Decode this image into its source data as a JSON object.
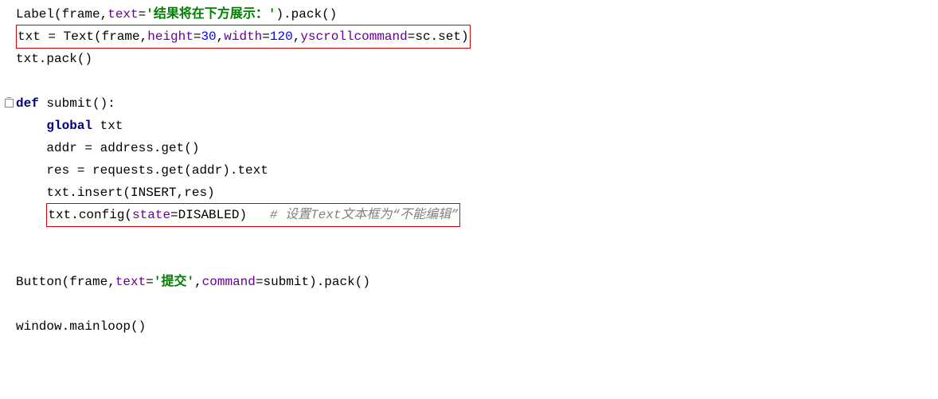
{
  "code": {
    "line1": {
      "t1": "Label(frame,",
      "t2": "text",
      "t3": "=",
      "t4": "'结果将在下方展示：'",
      "t5": ").pack()"
    },
    "line2": {
      "t1": "txt = Text(frame,",
      "t2": "height",
      "t3": "=",
      "t4": "30",
      "t5": ",",
      "t6": "width",
      "t7": "=",
      "t8": "120",
      "t9": ",",
      "t10": "yscrollcommand",
      "t11": "=sc.set)"
    },
    "line3": {
      "t1": "txt.pack()"
    },
    "line5": {
      "t1": "def",
      "t2": " ",
      "t3": "submit():"
    },
    "line6": {
      "t1": "    ",
      "t2": "global",
      "t3": " txt"
    },
    "line7": {
      "t1": "    addr = address.get()"
    },
    "line8": {
      "t1": "    res = requests.get(addr).text"
    },
    "line9": {
      "t1": "    txt.insert(INSERT,res)"
    },
    "line10": {
      "t1": "    ",
      "t2": "txt.config(",
      "t3": "state",
      "t4": "=DISABLED)",
      "t5": "   ",
      "t6": "# 设置Text文本框为“不能编辑”"
    },
    "line13": {
      "t1": "Button(frame,",
      "t2": "text",
      "t3": "=",
      "t4": "'提交'",
      "t5": ",",
      "t6": "command",
      "t7": "=submit).pack()"
    },
    "line15": {
      "t1": "window.mainloop()"
    }
  }
}
